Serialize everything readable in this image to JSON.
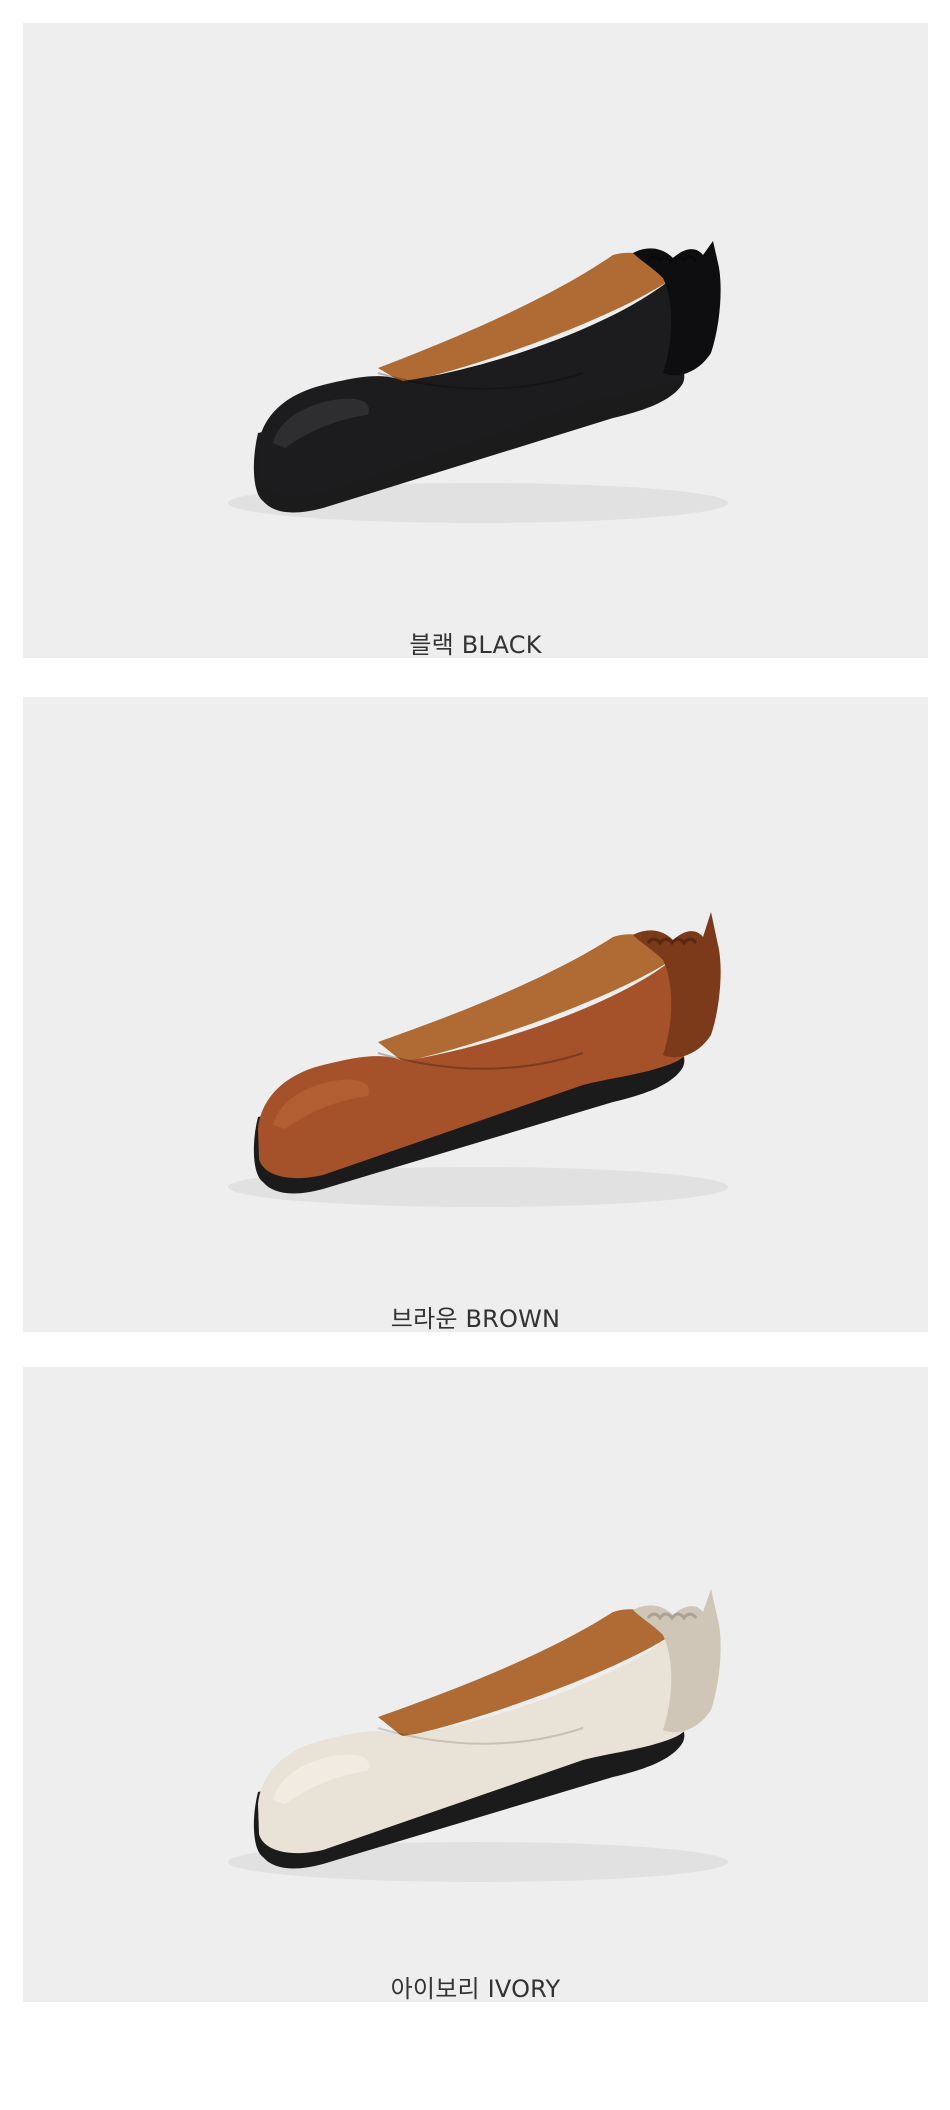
{
  "products": [
    {
      "label": "블랙 BLACK",
      "color": "#1c1c1e",
      "shade": "#0e0e10",
      "highlight": "#3a3a3c"
    },
    {
      "label": "브라운 BROWN",
      "color": "#a5522a",
      "shade": "#7c3a1b",
      "highlight": "#bb6838"
    },
    {
      "label": "아이보리 IVORY",
      "color": "#e9e2d6",
      "shade": "#cfc6b7",
      "highlight": "#f5f0e7"
    }
  ],
  "lining_color": "#b06a33",
  "sole_color": "#1b1b1b"
}
